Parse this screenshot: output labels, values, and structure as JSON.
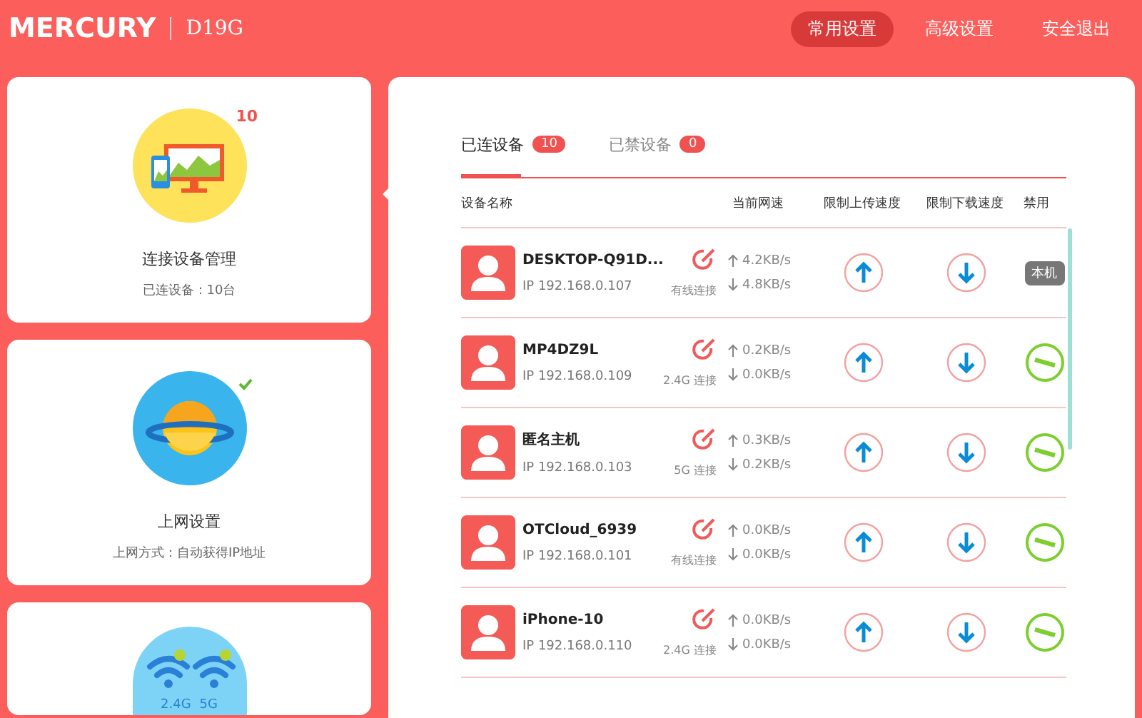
{
  "header": {
    "logo": "MERCURY",
    "model": "D19G",
    "nav": [
      {
        "label": "常用设置",
        "selected": true
      },
      {
        "label": "高级设置",
        "selected": false
      },
      {
        "label": "安全退出",
        "selected": false
      }
    ]
  },
  "cards": [
    {
      "kind": "devices",
      "title": "连接设备管理",
      "subtitle": "已连设备：10台",
      "badge": "10",
      "selected": true
    },
    {
      "kind": "internet",
      "title": "上网设置",
      "subtitle": "上网方式：自动获得IP地址",
      "badge_check": true,
      "selected": false
    },
    {
      "kind": "wifi",
      "band_labels": [
        "2.4G",
        "5G"
      ],
      "selected": false
    }
  ],
  "tabs": [
    {
      "label": "已连设备",
      "count": "10",
      "selected": true
    },
    {
      "label": "已禁设备",
      "count": "0",
      "selected": false
    }
  ],
  "columns": [
    "设备名称",
    "当前网速",
    "限制上传速度",
    "限制下载速度",
    "禁用"
  ],
  "devices": [
    {
      "name": "DESKTOP-Q91D...",
      "ip": "IP 192.168.0.107",
      "connection": "有线连接",
      "up": "4.2KB/s",
      "down": "4.8KB/s",
      "kind": "self",
      "disable_label": "本机"
    },
    {
      "name": "MP4DZ9L",
      "ip": "IP 192.168.0.109",
      "connection": "2.4G 连接",
      "up": "0.2KB/s",
      "down": "0.0KB/s",
      "kind": "other"
    },
    {
      "name": "匿名主机",
      "ip": "IP 192.168.0.103",
      "connection": "5G 连接",
      "up": "0.3KB/s",
      "down": "0.2KB/s",
      "kind": "other"
    },
    {
      "name": "OTCloud_6939",
      "ip": "IP 192.168.0.101",
      "connection": "有线连接",
      "up": "0.0KB/s",
      "down": "0.0KB/s",
      "kind": "other"
    },
    {
      "name": "iPhone-10",
      "ip": "IP 192.168.0.110",
      "connection": "2.4G 连接",
      "up": "0.0KB/s",
      "down": "0.0KB/s",
      "kind": "other"
    }
  ]
}
